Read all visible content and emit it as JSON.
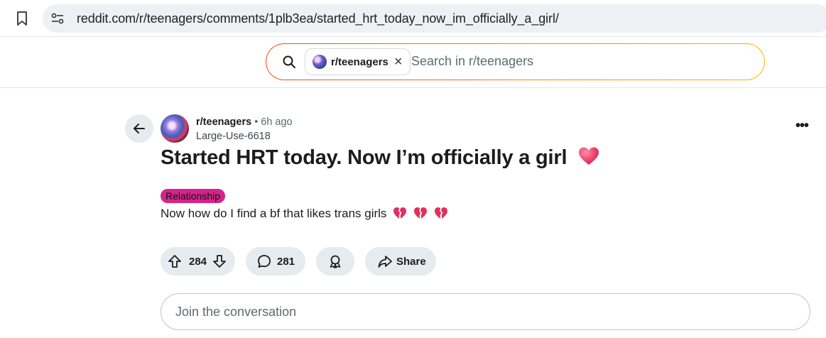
{
  "browser": {
    "url": "reddit.com/r/teenagers/comments/1plb3ea/started_hrt_today_now_im_officially_a_girl/"
  },
  "search": {
    "community_chip": "r/teenagers",
    "placeholder": "Search in r/teenagers"
  },
  "post": {
    "subreddit": "r/teenagers",
    "separator": "•",
    "time_ago": "6h ago",
    "author": "Large-Use-6618",
    "title": "Started HRT today. Now I’m officially a girl",
    "flair": "Relationship",
    "body": "Now how do I find a bf that likes trans girls",
    "more_label": "•••"
  },
  "actions": {
    "upvotes": "284",
    "comments": "281",
    "share_label": "Share"
  },
  "comment_box": {
    "placeholder": "Join the conversation"
  },
  "icons": [
    "bookmark-icon",
    "site-settings-icon",
    "search-icon",
    "close-icon",
    "back-arrow-icon",
    "heart-icon",
    "broken-heart-icon",
    "upvote-icon",
    "downvote-icon",
    "comment-icon",
    "award-icon",
    "share-icon"
  ],
  "colors": {
    "flair_bg": "#d4248b",
    "pill_bg": "#e5ebee",
    "heart": "#e8305a",
    "search_gradient_start": "#ff4500",
    "search_gradient_end": "#ffb000"
  }
}
